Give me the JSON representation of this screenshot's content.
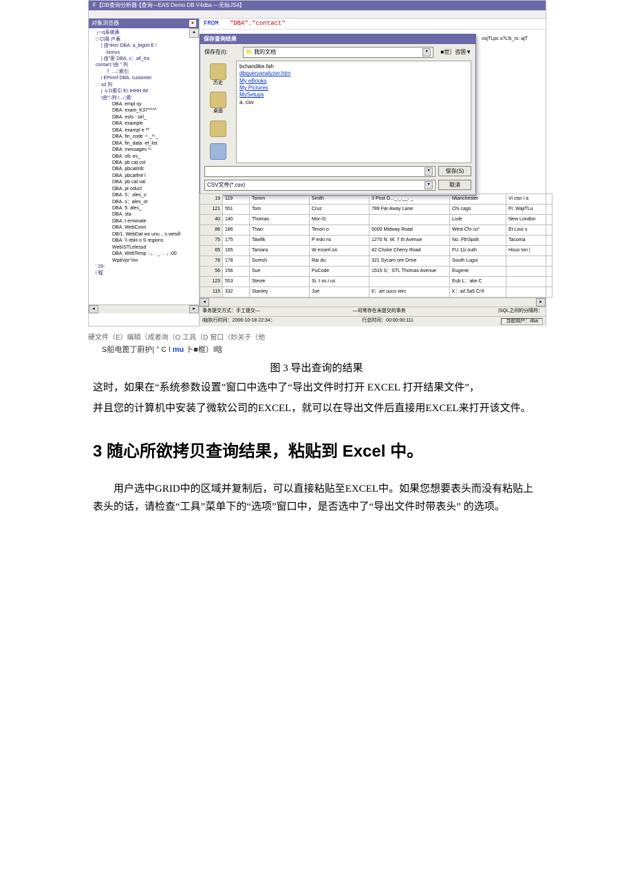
{
  "app": {
    "title_prefix": "F【DB查询分析器·【查询—EAS Demo DB V4dba —无标JS4】",
    "object_panel_title": "对象浏览器",
    "close_x": "×"
  },
  "tree": {
    "items": [
      {
        "cls": "lvl1",
        "t": "┌─q系统表"
      },
      {
        "cls": "lvl1",
        "t": "□ Cl用·户表"
      },
      {
        "cls": "lvl2",
        "t": "| 由³iHn! DBA. a_bigint E !"
      },
      {
        "cls": "lvl3",
        "t": "bonus"
      },
      {
        "cls": "lvl2",
        "t": "| 由\"匪 DBA. c：all_tra"
      },
      {
        "cls": "lvl1",
        "t": "contact !由 \" 列"
      },
      {
        "cls": "lvl3",
        "t": "？…□索引"
      },
      {
        "cls": "lvl2",
        "t": "i EPimrf DBA. customer"
      },
      {
        "cls": "lvl1",
        "t": ": :  sd 列"
      },
      {
        "cls": "lvl2",
        "t": "j .s·D索引 EI·IHHH IM"
      },
      {
        "cls": "lvl2",
        "t": "!由\"□列 !...□索'"
      },
      {
        "cls": "lvl4",
        "t": "DBA. empl oy"
      },
      {
        "cls": "lvl4",
        "t": "DBA. exam_K37^^^^"
      },
      {
        "cls": "lvl4",
        "t": "DBA. ests : sirl_"
      },
      {
        "cls": "lvl4",
        "t": "DBA. example"
      },
      {
        "cls": "lvl4",
        "t": "DBA. exampl e ⁰⁰"
      },
      {
        "cls": "lvl4",
        "t": "DBA. fin_code  ‑⁵ _¹⁵_"
      },
      {
        "cls": "lvl4",
        "t": "DBA. fin_data   ·ef_list"
      },
      {
        "cls": "lvl4",
        "t": "DBA. messages  ¹⁵"
      },
      {
        "cls": "lvl4",
        "t": "DBA. ofc                es_"
      },
      {
        "cls": "lvl4",
        "t": "DBA. pb cat col"
      },
      {
        "cls": "lvl4",
        "t": "DBA. pbcatmfc"
      },
      {
        "cls": "lvl4",
        "t": "DBA. pbcatfmt l"
      },
      {
        "cls": "lvl4",
        "t": "DBA. pb cat val"
      },
      {
        "cls": "lvl4",
        "t": "DBA. pl·oduct"
      },
      {
        "cls": "lvl4",
        "t": "DBA. 5：ales_o"
      },
      {
        "cls": "lvl4",
        "t": "DBA. s：ales_ot"
      },
      {
        "cls": "lvl4",
        "t": "DBA. 5: ales_"
      },
      {
        "cls": "lvl4",
        "t": "DBA. sta"
      },
      {
        "cls": "lvl4",
        "t": "DBA. t erminate"
      },
      {
        "cls": "lvl4",
        "t": "DBA. WebConn"
      },
      {
        "cls": "lvl4",
        "t": "DB/1. WebDat  ws unu ...s wesill"
      },
      {
        "cls": "lvl4",
        "t": "DBA. \\\\ ebH o S regions"
      },
      {
        "cls": "lvl4",
        "t": "Web\\STLelessd"
      },
      {
        "cls": "lvl4",
        "t": "DBA. WebTemp : ₁. . _ . . ₁ ₇00"
      },
      {
        "cls": "lvl4",
        "t": "WpbVpr°inn"
      },
      {
        "cls": "lvl1",
        "t": "' 29-"
      },
      {
        "cls": "lvl1",
        "t": "i 程"
      }
    ]
  },
  "sql": {
    "kw": "FROM",
    "str": "\"DBA\".\"contact\""
  },
  "dialog": {
    "title": "保存查询结果",
    "save_in_label": "保存在(I):",
    "save_in_value": "我的文档",
    "back_hint": "■世］咨国▼",
    "places": [
      {
        "label": "历史",
        "cls": ""
      },
      {
        "label": "桌面",
        "cls": ""
      },
      {
        "label": "",
        "cls": ""
      },
      {
        "label": "",
        "cls": "computer"
      }
    ],
    "files": [
      {
        "t": "bchandike.fah",
        "link": false
      },
      {
        "t": "dbqueryanalyzer.htm",
        "link": true
      },
      {
        "t": "My eBooks",
        "link": true
      },
      {
        "t": "My Pictures",
        "link": true
      },
      {
        "t": "MySetups",
        "link": true
      },
      {
        "t": "a. csv",
        "link": false
      }
    ],
    "filename_label": "",
    "filename_value": "",
    "type_label": "",
    "type_value": "CSV文件(*.csv)",
    "save_btn": "保存(S)",
    "cancel_btn": "取消"
  },
  "bg": {
    "frag1": "cojTLps  u?L5i_rs: ajT"
  },
  "grid": {
    "rows": [
      {
        "a": "19",
        "b": "119",
        "c": "Tomm",
        "d": "Smith",
        "e": "3 Post G..._._.__. _",
        "f": "Mianchester"
      },
      {
        "a": "121",
        "b": "551",
        "c": "Tom",
        "d": "Cruz",
        "e": "789 Far Away Lane",
        "f": "Chi cago"
      },
      {
        "a": "40",
        "b": "140",
        "c": "Thomas",
        "d": "Mor-iS",
        "e": "",
        "f": "Liule"
      },
      {
        "a": "86",
        "b": "186",
        "c": "Thao",
        "d": "Tenori o",
        "e": "5000 Midway Road",
        "f": "West Chi co°"
      },
      {
        "a": "75",
        "b": "175",
        "c": "Tawfik",
        "d": "P eski ns",
        "e": "1270 N. W. 7 th Avenue",
        "f": "No. FthSpok"
      },
      {
        "a": "65",
        "b": "165",
        "c": "Tamara",
        "d": "W enserl.on",
        "e": "42 Choke Cherry Road",
        "f": "FU·11i outh"
      },
      {
        "a": "78",
        "b": "178",
        "c": "Suresh",
        "d": "Rai du",
        "e": "321 Sycam ore Drive",
        "f": "South Lugui"
      },
      {
        "a": "56",
        "b": "156",
        "c": "Sue",
        "d": "PuCode",
        "e": "1515 S：STL Thomas Avenue",
        "f": "Eugene"
      },
      {
        "a": "123",
        "b": "553",
        "c": "Stevie",
        "d": "Si. t xo.i us",
        "e": "",
        "f": "Eub L：ake C"
      },
      {
        "a": "115",
        "b": "332",
        "c": "Stanley",
        "d": "Jue",
        "e": "6：art uuco wirc",
        "f": "K：arl.5a5 Ci'¢"
      }
    ],
    "cities_extra": [
      "Vi ctor i a",
      "Ft. WajiTLu",
      "New London",
      "Et Loui s",
      "Tacoma",
      "Hous ton |"
    ]
  },
  "status": {
    "a": "事务提交方式：手工提交—",
    "b": "—司常存在未提交的事务",
    "c": "|SQL之间的分隔符：",
    "d": "当前用户：dba",
    "time1": "i始执行时间：2006-10-18 22:34：·",
    "time2": "行总时间：00:00:00:111"
  },
  "under_shot": "硬文件（E）编辑（成者询（O  工具（D 窗口（妙关于（他",
  "taskbar": {
    "t1": "S船电篦丁蔚护|",
    "t2": "  \" C l ",
    "t3": "mu",
    "t4": " 卜■框）l晗"
  },
  "figure_caption": "图 3 导出查询的结果",
  "para1a": "这时，如果在“系统参数设置”窗口中选中了“导出文件时打开 EXCEL 打开结果文件”，",
  "para1b": "并且您的计算机中安装了微软公司的EXCEL，就可以在导出文件后直接用EXCEL来打开该文件。",
  "h2": "3  随心所欲拷贝查询结果，粘贴到 Excel 中。",
  "para2": "用户选中GRID中的区域并复制后，可以直接粘贴至EXCEL中。如果您想要表头而没有粘贴上表头的话，请检查“工具”菜单下的“选项”窗口中，是否选中了“导出文件时带表头” 的选项。"
}
